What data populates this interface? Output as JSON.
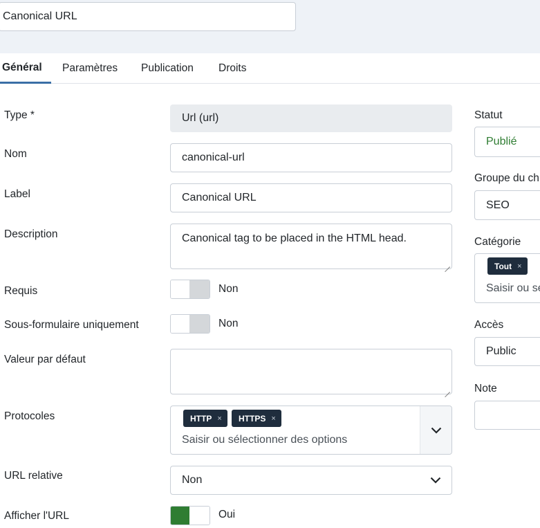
{
  "header": {
    "title_value": "Canonical URL"
  },
  "tabs": [
    {
      "label": "Général",
      "active": true
    },
    {
      "label": "Paramètres",
      "active": false
    },
    {
      "label": "Publication",
      "active": false
    },
    {
      "label": "Droits",
      "active": false
    }
  ],
  "form": {
    "type": {
      "label": "Type *",
      "value": "Url (url)"
    },
    "name": {
      "label": "Nom",
      "value": "canonical-url"
    },
    "field_label": {
      "label": "Label",
      "value": "Canonical URL"
    },
    "description": {
      "label": "Description",
      "value": "Canonical tag to be placed in the HTML head."
    },
    "required": {
      "label": "Requis",
      "value": "Non"
    },
    "subform_only": {
      "label": "Sous-formulaire uniquement",
      "value": "Non"
    },
    "default_value": {
      "label": "Valeur par défaut",
      "value": ""
    },
    "protocols": {
      "label": "Protocoles",
      "chips": [
        "HTTP",
        "HTTPS"
      ],
      "placeholder": "Saisir ou sélectionner des options"
    },
    "relative_url": {
      "label": "URL relative",
      "value": "Non"
    },
    "show_url": {
      "label": "Afficher l'URL",
      "value": "Oui"
    }
  },
  "sidebar": {
    "status": {
      "label": "Statut",
      "value": "Publié",
      "value_color": "#2f7d32"
    },
    "field_group": {
      "label": "Groupe du ch",
      "value": "SEO"
    },
    "category": {
      "label": "Catégorie",
      "chip": "Tout",
      "placeholder": "Saisir ou se"
    },
    "access": {
      "label": "Accès",
      "value": "Public"
    },
    "note": {
      "label": "Note",
      "value": ""
    }
  },
  "icons": {
    "chip_remove": "×",
    "dropdown": "chevron-down-icon"
  }
}
